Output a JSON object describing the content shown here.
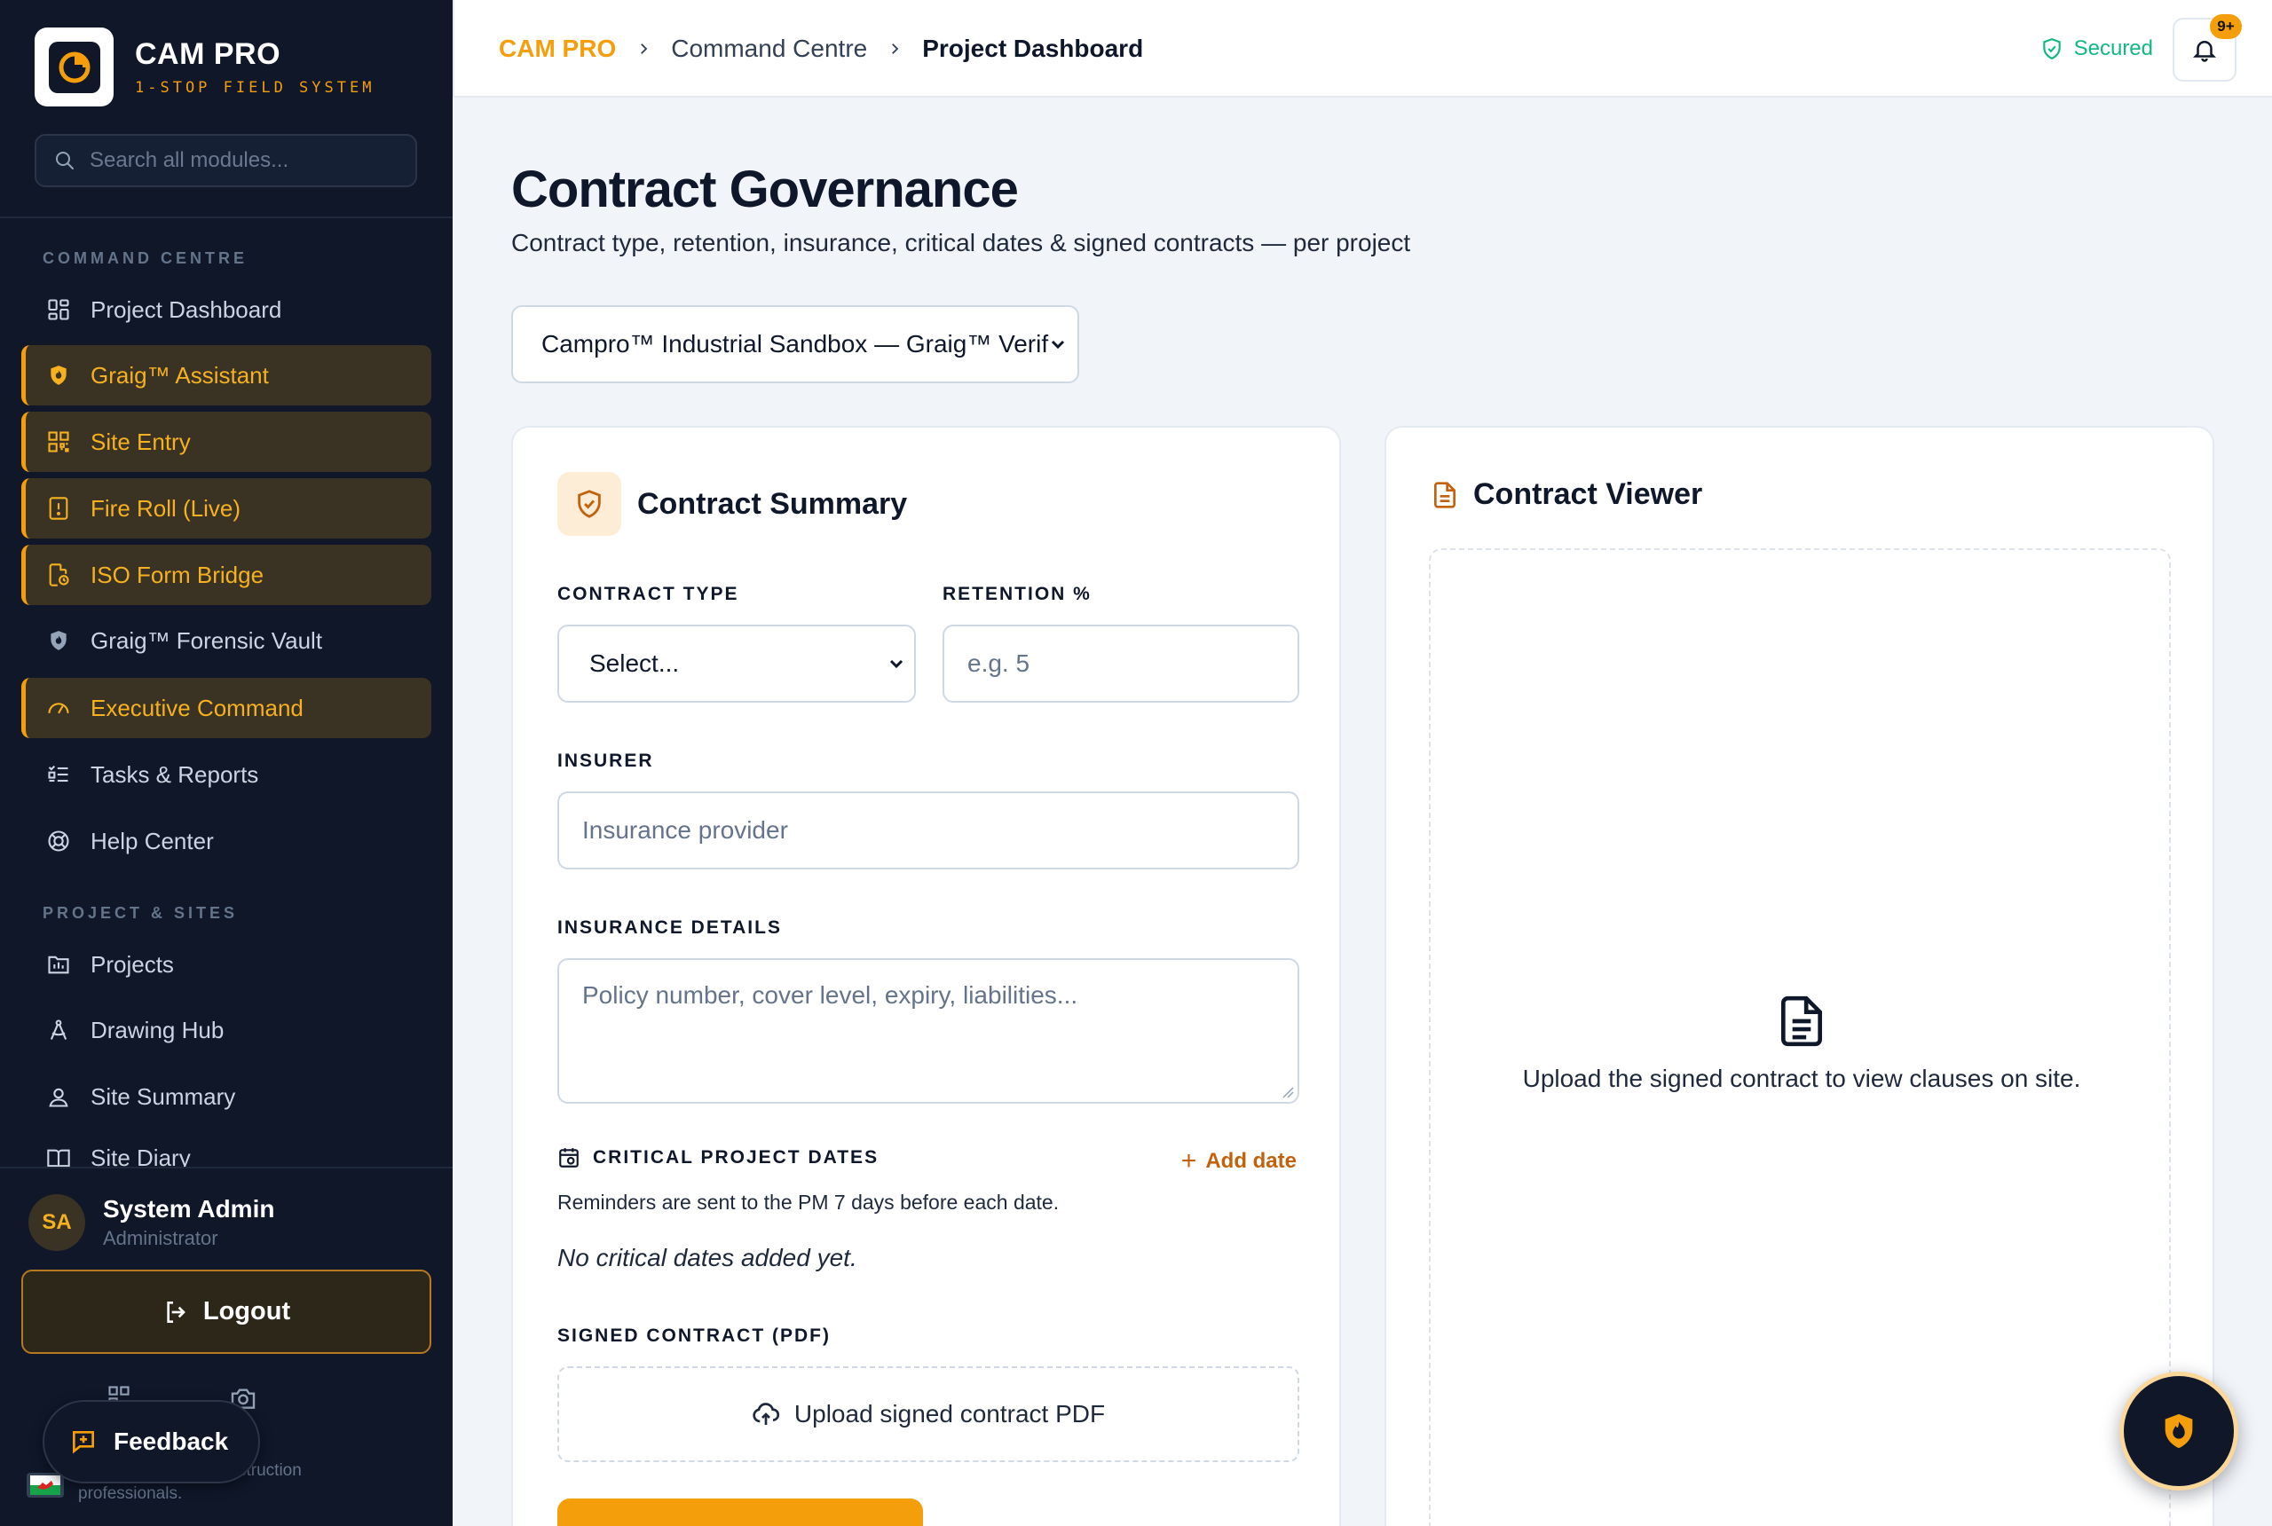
{
  "brand": {
    "name": "CAM PRO",
    "tagline": "1-STOP FIELD SYSTEM"
  },
  "sidebar": {
    "search_placeholder": "Search all modules...",
    "section_command": "COMMAND CENTRE",
    "section_project": "PROJECT & SITES",
    "items": [
      {
        "label": "Project Dashboard",
        "icon": "grid-icon",
        "active": false
      },
      {
        "label": "Graig™ Assistant",
        "icon": "shield-flame-icon",
        "active": true
      },
      {
        "label": "Site Entry",
        "icon": "qr-code-icon",
        "active": true
      },
      {
        "label": "Fire Roll (Live)",
        "icon": "alert-file-icon",
        "active": true
      },
      {
        "label": "ISO Form Bridge",
        "icon": "file-sync-icon",
        "active": true
      },
      {
        "label": "Graig™ Forensic Vault",
        "icon": "shield-flame-icon",
        "active": false
      },
      {
        "label": "Executive Command",
        "icon": "gauge-icon",
        "active": true
      },
      {
        "label": "Tasks & Reports",
        "icon": "list-check-icon",
        "active": false
      },
      {
        "label": "Help Center",
        "icon": "lifebuoy-icon",
        "active": false
      },
      {
        "label": "Projects",
        "icon": "chart-folder-icon",
        "active": false
      },
      {
        "label": "Drawing Hub",
        "icon": "compass-drawing-icon",
        "active": false
      },
      {
        "label": "Site Summary",
        "icon": "map-pin-user-icon",
        "active": false
      },
      {
        "label": "Site Diary",
        "icon": "book-open-icon",
        "active": false
      }
    ],
    "user": {
      "initials": "SA",
      "name": "System Admin",
      "role": "Administrator"
    },
    "logout_label": "Logout",
    "footer_text": "...struction professionals.",
    "footer_line1": "struction",
    "footer_line2": "professionals."
  },
  "feedback_label": "Feedback",
  "topbar": {
    "breadcrumb": [
      "CAM PRO",
      "Command Centre",
      "Project Dashboard"
    ],
    "secured_label": "Secured",
    "notif_count": "9+"
  },
  "page": {
    "title": "Contract Governance",
    "subtitle": "Contract type, retention, insurance, critical dates & signed contracts — per project",
    "project_selected": "Campro™ Industrial Sandbox — Graig™ Verif"
  },
  "summary": {
    "title": "Contract Summary",
    "contract_type_label": "CONTRACT TYPE",
    "contract_type_value": "Select...",
    "retention_label": "RETENTION %",
    "retention_placeholder": "e.g. 5",
    "insurer_label": "INSURER",
    "insurer_placeholder": "Insurance provider",
    "insurance_details_label": "INSURANCE DETAILS",
    "insurance_details_placeholder": "Policy number, cover level, expiry, liabilities...",
    "critical_dates_label": "CRITICAL PROJECT DATES",
    "add_date_label": "Add date",
    "reminder_text": "Reminders are sent to the PM 7 days before each date.",
    "no_dates_text": "No critical dates added yet.",
    "signed_contract_label": "SIGNED CONTRACT (PDF)",
    "upload_label": "Upload signed contract PDF"
  },
  "viewer": {
    "title": "Contract Viewer",
    "empty_text": "Upload the signed contract to view clauses on site."
  },
  "colors": {
    "accent": "#f59e0b",
    "sidebar_bg": "#0f1729",
    "secured": "#10b981",
    "link_orange": "#c2620c"
  }
}
